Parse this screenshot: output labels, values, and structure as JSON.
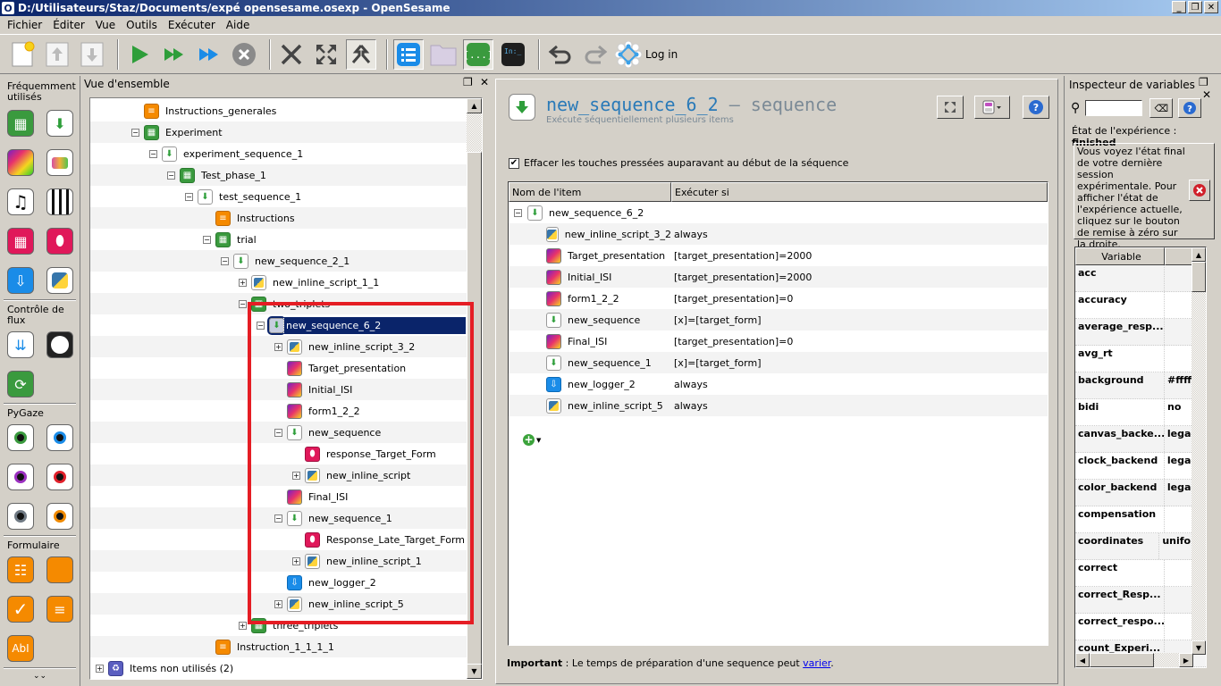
{
  "window": {
    "title": "D:/Utilisateurs/Staz/Documents/expé opensesame.osexp - OpenSesame",
    "app_icon": "O",
    "controls": [
      "minimize",
      "restore",
      "close"
    ]
  },
  "menu": [
    "Fichier",
    "Éditer",
    "Vue",
    "Outils",
    "Exécuter",
    "Aide"
  ],
  "toolbar": {
    "buttons": [
      "new-experiment",
      "open-up",
      "save-down",
      "run",
      "run-fast",
      "run-quick",
      "stop",
      "close-all-tabs",
      "fullscreen",
      "merge",
      "overview",
      "file-pool",
      "variable-inspector",
      "debug-window",
      "undo",
      "redo"
    ],
    "login_label": "Log in"
  },
  "toolbox": {
    "sections": [
      {
        "title": "Fréquemment utilisés",
        "items": [
          "loop",
          "sequence",
          "sketchpad",
          "feedback",
          "sampler",
          "synth",
          "keyboard_response",
          "mouse_response",
          "logger",
          "inline_script"
        ]
      },
      {
        "title": "Contrôle de flux",
        "items": [
          "coroutines",
          "advanced_delay",
          "repeat_cycle"
        ]
      },
      {
        "title": "PyGaze",
        "items": [
          "pygaze_drift_correct",
          "pygaze_init",
          "pygaze_log",
          "pygaze_start_recording",
          "pygaze_stop_recording",
          "pygaze_wait"
        ]
      },
      {
        "title": "Formulaire",
        "items": [
          "form_multiple_choice",
          "form_base",
          "form_consent",
          "form_text_display",
          "form_text_input"
        ]
      }
    ],
    "more": "⌄⌄"
  },
  "overview": {
    "title": "Vue d'ensemble",
    "tree": [
      {
        "label": "Instructions_generales",
        "type": "form",
        "level": 3,
        "expander": "none"
      },
      {
        "label": "Experiment",
        "type": "loop",
        "level": 3,
        "expander": "minus"
      },
      {
        "label": "experiment_sequence_1",
        "type": "sequence",
        "level": 4,
        "expander": "minus"
      },
      {
        "label": "Test_phase_1",
        "type": "loop",
        "level": 5,
        "expander": "minus"
      },
      {
        "label": "test_sequence_1",
        "type": "sequence",
        "level": 6,
        "expander": "minus"
      },
      {
        "label": "Instructions",
        "type": "form",
        "level": 7,
        "expander": "none"
      },
      {
        "label": "trial",
        "type": "loop",
        "level": 7,
        "expander": "minus"
      },
      {
        "label": "new_sequence_2_1",
        "type": "sequence",
        "level": 8,
        "expander": "minus"
      },
      {
        "label": "new_inline_script_1_1",
        "type": "inline",
        "level": 9,
        "expander": "plus"
      },
      {
        "label": "two_triplets",
        "type": "loop",
        "level": 9,
        "expander": "minus"
      },
      {
        "label": "new_sequence_6_2",
        "type": "sequence",
        "level": 10,
        "expander": "minus",
        "selected": true
      },
      {
        "label": "new_inline_script_3_2",
        "type": "inline",
        "level": 11,
        "expander": "plus"
      },
      {
        "label": "Target_presentation",
        "type": "sketchpad",
        "level": 11,
        "expander": "none"
      },
      {
        "label": "Initial_ISI",
        "type": "sketchpad",
        "level": 11,
        "expander": "none"
      },
      {
        "label": "form1_2_2",
        "type": "sketchpad",
        "level": 11,
        "expander": "none"
      },
      {
        "label": "new_sequence",
        "type": "sequence",
        "level": 11,
        "expander": "minus"
      },
      {
        "label": "response_Target_Form",
        "type": "mouse",
        "level": 12,
        "expander": "none"
      },
      {
        "label": "new_inline_script",
        "type": "inline",
        "level": 12,
        "expander": "plus"
      },
      {
        "label": "Final_ISI",
        "type": "sketchpad",
        "level": 11,
        "expander": "none"
      },
      {
        "label": "new_sequence_1",
        "type": "sequence",
        "level": 11,
        "expander": "minus"
      },
      {
        "label": "Response_Late_Target_Form",
        "type": "mouse",
        "level": 12,
        "expander": "none"
      },
      {
        "label": "new_inline_script_1",
        "type": "inline",
        "level": 12,
        "expander": "plus"
      },
      {
        "label": "new_logger_2",
        "type": "logger",
        "level": 11,
        "expander": "none"
      },
      {
        "label": "new_inline_script_5",
        "type": "inline",
        "level": 11,
        "expander": "plus"
      },
      {
        "label": "three_triplets",
        "type": "loop",
        "level": 9,
        "expander": "plus"
      },
      {
        "label": "Instruction_1_1_1_1",
        "type": "form",
        "level": 7,
        "expander": "none"
      },
      {
        "label": "Items non utilisés (2)",
        "type": "unused",
        "level": 0,
        "expander": "plus"
      }
    ]
  },
  "editor": {
    "item_name": "new_sequence_6_2",
    "separator": " — ",
    "item_type": "sequence",
    "description": "Exécute séquentiellement plusieurs items",
    "flush_checkbox_label": "Effacer les touches pressées auparavant au début de la séquence",
    "flush_checked": true,
    "columns": [
      "Nom de l'item",
      "Exécuter si"
    ],
    "root": "new_sequence_6_2",
    "rows": [
      {
        "name": "new_inline_script_3_2",
        "type": "inline",
        "run_if": "always"
      },
      {
        "name": "Target_presentation",
        "type": "sketchpad",
        "run_if": "[target_presentation]=2000"
      },
      {
        "name": "Initial_ISI",
        "type": "sketchpad",
        "run_if": "[target_presentation]=2000"
      },
      {
        "name": "form1_2_2",
        "type": "sketchpad",
        "run_if": "[target_presentation]=0"
      },
      {
        "name": "new_sequence",
        "type": "sequence",
        "run_if": "[x]=[target_form]"
      },
      {
        "name": "Final_ISI",
        "type": "sketchpad",
        "run_if": "[target_presentation]=0"
      },
      {
        "name": "new_sequence_1",
        "type": "sequence",
        "run_if": "[x]=[target_form]"
      },
      {
        "name": "new_logger_2",
        "type": "logger",
        "run_if": "always"
      },
      {
        "name": "new_inline_script_5",
        "type": "inline",
        "run_if": "always"
      }
    ],
    "note_bold": "Important",
    "note_text": " : Le temps de préparation d'une sequence peut ",
    "note_link": "varier",
    "note_end": "."
  },
  "inspector": {
    "title": "Inspecteur de variables",
    "search_value": "",
    "state_label": "État de l'expérience : ",
    "state_value": "finished",
    "info": "Vous voyez l'état final de votre dernière session expérimentale. Pour afficher l'état de l'expérience actuelle, cliquez sur le bouton de remise à zéro sur la droite.",
    "columns": [
      "Variable",
      "V"
    ],
    "variables": [
      {
        "name": "acc",
        "value": ""
      },
      {
        "name": "accuracy",
        "value": ""
      },
      {
        "name": "average_resp...",
        "value": ""
      },
      {
        "name": "avg_rt",
        "value": ""
      },
      {
        "name": "background",
        "value": "#ffffff"
      },
      {
        "name": "bidi",
        "value": "no"
      },
      {
        "name": "canvas_backe...",
        "value": "legacy"
      },
      {
        "name": "clock_backend",
        "value": "legacy"
      },
      {
        "name": "color_backend",
        "value": "legacy"
      },
      {
        "name": "compensation",
        "value": ""
      },
      {
        "name": "coordinates",
        "value": "uniform"
      },
      {
        "name": "correct",
        "value": ""
      },
      {
        "name": "correct_Resp...",
        "value": ""
      },
      {
        "name": "correct_respo...",
        "value": ""
      },
      {
        "name": "count_Experi...",
        "value": ""
      }
    ]
  },
  "colors": {
    "accent_title": "#2a7ab8",
    "selection": "#0a246a",
    "highlight_box": "#e51d24"
  }
}
